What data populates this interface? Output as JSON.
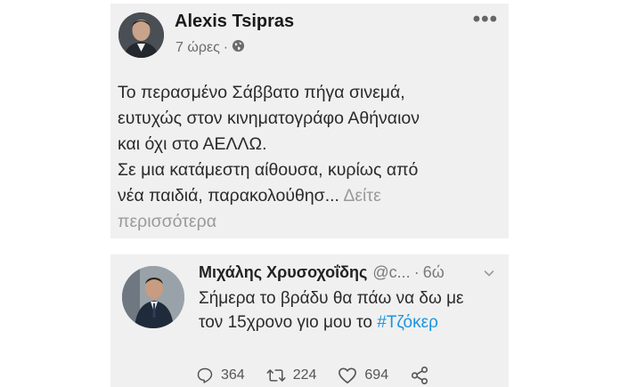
{
  "facebook_post": {
    "author": "Alexis Tsipras",
    "time": "7 ώρες",
    "separator": "·",
    "body_lines": [
      "Το περασμένο Σάββατο πήγα σινεμά,",
      "ευτυχώς στον κινηματογράφο Αθήναιον",
      "και όχι στο ΑΕΛΛΩ.",
      "Σε μια κατάμεστη αίθουσα, κυρίως από",
      "νέα παιδιά, παρακολούθησ..."
    ],
    "see_more_part1": "Δείτε",
    "see_more_part2": "περισσότερα",
    "more_icon": "•••",
    "privacy_icon": "globe-icon"
  },
  "tweet": {
    "name": "Μιχάλης Χρυσοχοΐδης",
    "handle": "@c...",
    "separator": "·",
    "time": "6ώ",
    "text_line1": "Σήμερα το βράδυ θα πάω να δω με",
    "text_line2_prefix": "τον 15χρονο γιο μου το ",
    "hashtag": "#Τζόκερ",
    "replies": "364",
    "retweets": "224",
    "likes": "694",
    "colors": {
      "hashtag": "#1b95e0",
      "card_bg": "#f0f0f0"
    }
  }
}
